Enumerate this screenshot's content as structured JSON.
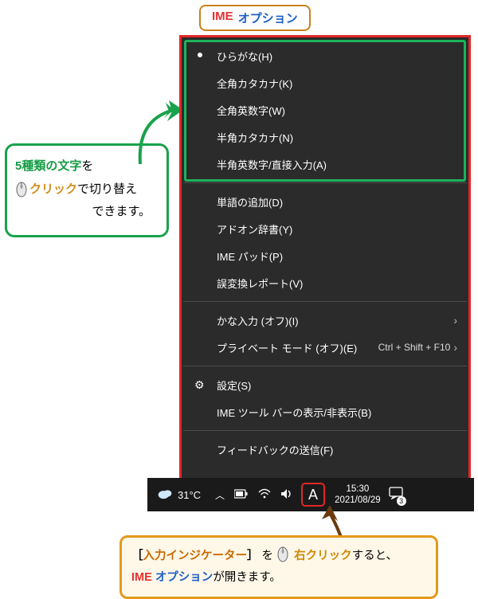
{
  "title": {
    "ime": "IME",
    "option": "オプション"
  },
  "callout_green": {
    "five_types": "5種類の文字",
    "wo": "を",
    "click": "クリック",
    "de_switch": "で切り替え",
    "dekimasu": "できます。"
  },
  "callout_orange": {
    "open_br": "［",
    "indicator": "入力インジケーター",
    "close_br": "］",
    "wo": "を",
    "right_click": "右クリック",
    "suruto": "すると、",
    "ime": "IME",
    "option": "オプション",
    "opens": "が開きます。"
  },
  "menu": {
    "mode_items": [
      {
        "label": "ひらがな(H)",
        "selected": true
      },
      {
        "label": "全角カタカナ(K)",
        "selected": false
      },
      {
        "label": "全角英数字(W)",
        "selected": false
      },
      {
        "label": "半角カタカナ(N)",
        "selected": false
      },
      {
        "label": "半角英数字/直接入力(A)",
        "selected": false
      }
    ],
    "group2": [
      {
        "label": "単語の追加(D)"
      },
      {
        "label": "アドオン辞書(Y)"
      },
      {
        "label": "IME パッド(P)"
      },
      {
        "label": "誤変換レポート(V)"
      }
    ],
    "group3": [
      {
        "label": "かな入力 (オフ)(I)",
        "arrow": true
      },
      {
        "label": "プライベート モード (オフ)(E)",
        "shortcut": "Ctrl + Shift + F10",
        "arrow": true
      }
    ],
    "group4": [
      {
        "label": "設定(S)",
        "gear": true
      },
      {
        "label": "IME ツール バーの表示/非表示(B)"
      }
    ],
    "group5": [
      {
        "label": "フィードバックの送信(F)"
      }
    ]
  },
  "taskbar": {
    "temp": "31°C",
    "ime_letter": "A",
    "time": "15:30",
    "date": "2021/08/29",
    "notif_count": "3"
  }
}
